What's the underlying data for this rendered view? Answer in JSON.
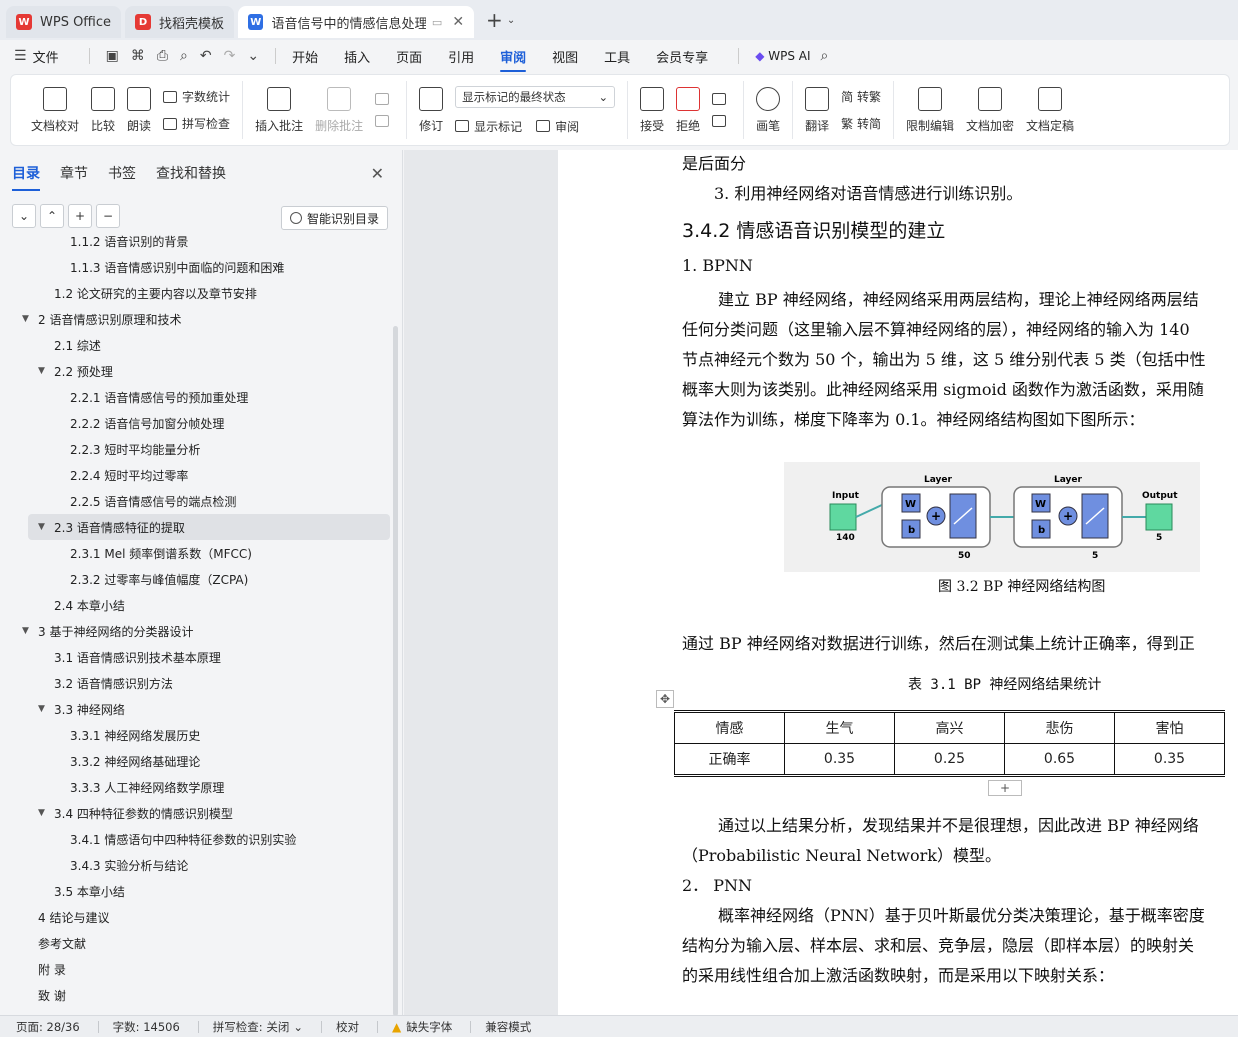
{
  "tabs": [
    {
      "label": "WPS Office",
      "color": "#e53935",
      "glyph": "W"
    },
    {
      "label": "找稻壳模板",
      "color": "#e53935",
      "glyph": "D"
    },
    {
      "label": "语音信号中的情感信息处理研究",
      "color": "#2f6fe4",
      "glyph": "W",
      "active": true
    }
  ],
  "menu": {
    "file": "文件",
    "items": [
      "开始",
      "插入",
      "页面",
      "引用",
      "审阅",
      "视图",
      "工具",
      "会员专享"
    ],
    "active": "审阅",
    "ai": "WPS AI"
  },
  "ribbon": {
    "doc_check": "文档校对",
    "compare": "比较",
    "read_aloud": "朗读",
    "word_count": "字数统计",
    "spell_check": "拼写检查",
    "insert_comment": "插入批注",
    "delete_comment": "删除批注",
    "revise": "修订",
    "markup_mode": "显示标记的最终状态",
    "show_markup": "显示标记",
    "review_pane": "审阅",
    "accept": "接受",
    "reject": "拒绝",
    "pen": "画笔",
    "translate": "翻译",
    "to_traditional": "简 转繁",
    "to_simplified": "繁 转简",
    "restrict_edit": "限制编辑",
    "encrypt": "文档加密",
    "finalize": "文档定稿"
  },
  "panel": {
    "tabs": [
      "目录",
      "章节",
      "书签",
      "查找和替换"
    ],
    "active_tab": "目录",
    "smart_toc": "智能识别目录",
    "toc": [
      {
        "label": "1.1.2 语音识别的背景",
        "level": 3,
        "arrow": ""
      },
      {
        "label": "1.1.3 语音情感识别中面临的问题和困难",
        "level": 3,
        "arrow": ""
      },
      {
        "label": "1.2 论文研究的主要内容以及章节安排",
        "level": 2,
        "arrow": ""
      },
      {
        "label": "2  语音情感识别原理和技术",
        "level": 1,
        "arrow": "▼"
      },
      {
        "label": "2.1 综述",
        "level": 2,
        "arrow": ""
      },
      {
        "label": "2.2  预处理",
        "level": 2,
        "arrow": "▼"
      },
      {
        "label": "2.2.1 语音情感信号的预加重处理",
        "level": 3,
        "arrow": ""
      },
      {
        "label": "2.2.2 语音信号加窗分帧处理",
        "level": 3,
        "arrow": ""
      },
      {
        "label": "2.2.3  短时平均能量分析",
        "level": 3,
        "arrow": ""
      },
      {
        "label": "2.2.4  短时平均过零率",
        "level": 3,
        "arrow": ""
      },
      {
        "label": "2.2.5  语音情感信号的端点检测",
        "level": 3,
        "arrow": ""
      },
      {
        "label": "2.3 语音情感特征的提取",
        "level": 2,
        "arrow": "▼",
        "selected": true
      },
      {
        "label": "2.3.1 Mel 频率倒谱系数（MFCC)",
        "level": 3,
        "arrow": ""
      },
      {
        "label": "2.3.2 过零率与峰值幅度（ZCPA)",
        "level": 3,
        "arrow": ""
      },
      {
        "label": "2.4 本章小结",
        "level": 2,
        "arrow": ""
      },
      {
        "label": "3  基于神经网络的分类器设计",
        "level": 1,
        "arrow": "▼"
      },
      {
        "label": "3.1  语音情感识别技术基本原理",
        "level": 2,
        "arrow": ""
      },
      {
        "label": "3.2 语音情感识别方法",
        "level": 2,
        "arrow": ""
      },
      {
        "label": "3.3 神经网络",
        "level": 2,
        "arrow": "▼"
      },
      {
        "label": "3.3.1 神经网络发展历史",
        "level": 3,
        "arrow": ""
      },
      {
        "label": "3.3.2 神经网络基础理论",
        "level": 3,
        "arrow": ""
      },
      {
        "label": "3.3.3 人工神经网络数学原理",
        "level": 3,
        "arrow": ""
      },
      {
        "label": "3.4 四种特征参数的情感识别模型",
        "level": 2,
        "arrow": "▼"
      },
      {
        "label": "3.4.1 情感语句中四种特征参数的识别实验",
        "level": 3,
        "arrow": ""
      },
      {
        "label": "3.4.3 实验分析与结论",
        "level": 3,
        "arrow": ""
      },
      {
        "label": "3.5 本章小结",
        "level": 2,
        "arrow": ""
      },
      {
        "label": "4  结论与建议",
        "level": 1,
        "arrow": ""
      },
      {
        "label": "参考文献",
        "level": 1,
        "arrow": ""
      },
      {
        "label": "附  录",
        "level": 1,
        "arrow": ""
      },
      {
        "label": "致  谢",
        "level": 1,
        "arrow": ""
      }
    ]
  },
  "doc": {
    "line_top": "是后面分",
    "item3": "3.  利用神经网络对语音情感进行训练识别。",
    "heading": "3.4.2  情感语音识别模型的建立",
    "bpnn_title": "1. BPNN",
    "p1": [
      "建立 BP 神经网络，神经网络采用两层结构，理论上神经网络两层结",
      "任何分类问题（这里输入层不算神经网络的层），神经网络的输入为 140",
      "节点神经元个数为 50 个，输出为 5 维，这 5 维分别代表 5 类（包括中性",
      "概率大则为该类别。此神经网络采用 sigmoid 函数作为激活函数，采用随",
      "算法作为训练，梯度下降率为 0.1。神经网络结构图如下图所示："
    ],
    "figure": {
      "input_label": "Input",
      "input_size": "140",
      "layer1_label": "Layer",
      "layer1_size": "50",
      "layer2_label": "Layer",
      "layer2_size": "5",
      "output_label": "Output",
      "output_size": "5",
      "w": "W",
      "b": "b"
    },
    "figure_caption": "图 3.2 BP 神经网络结构图",
    "p2": "通过 BP 神经网络对数据进行训练，然后在测试集上统计正确率，得到正",
    "table_caption": "表 3.1  BP 神经网络结果统计",
    "table": {
      "header": [
        "情感",
        "生气",
        "高兴",
        "悲伤",
        "害怕"
      ],
      "row": [
        "正确率",
        "0.35",
        "0.25",
        "0.65",
        "0.35"
      ]
    },
    "p3": [
      "通过以上结果分析，发现结果并不是很理想，因此改进 BP 神经网络",
      "（Probabilistic Neural Network）模型。"
    ],
    "pnn_title": "2．  PNN",
    "p4": [
      "概率神经网络（PNN）基于贝叶斯最优分类决策理论，基于概率密度",
      "结构分为输入层、样本层、求和层、竞争层，隐层（即样本层）的映射关",
      "的采用线性组合加上激活函数映射，而是采用以下映射关系："
    ]
  },
  "status": {
    "page": "页面: 28/36",
    "words": "字数: 14506",
    "spell": "拼写检查: 关闭",
    "proof": "校对",
    "missing_font": "缺失字体",
    "compat": "兼容模式"
  },
  "colors": {
    "accent": "#1d5fd8",
    "figure_green": "#5fd8a0",
    "figure_blue": "#6f8fe0"
  }
}
